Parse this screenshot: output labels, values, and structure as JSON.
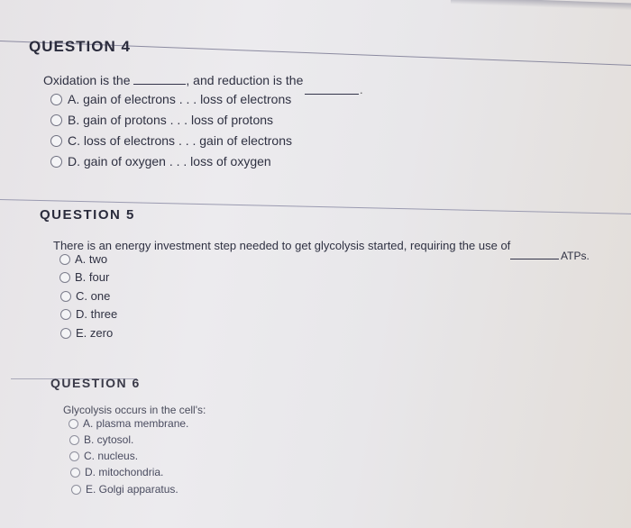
{
  "questions": [
    {
      "title": "QUESTION 4",
      "prompt_part1": "Oxidation is the",
      "prompt_part2": ", and reduction is the",
      "prompt_end": ".",
      "options": [
        {
          "letter": "A",
          "label": "A. gain of electrons . . . loss of electrons",
          "selected": false
        },
        {
          "letter": "B",
          "label": "B. gain of protons . . . loss of protons",
          "selected": false
        },
        {
          "letter": "C",
          "label": "C. loss of electrons . . . gain of electrons",
          "selected": false
        },
        {
          "letter": "D",
          "label": "D. gain of oxygen . . . loss of oxygen",
          "selected": false
        }
      ]
    },
    {
      "title": "QUESTION 5",
      "prompt_part1": "There is an energy investment step needed to get glycolysis started, requiring the use of",
      "prompt_part2": "ATPs.",
      "options": [
        {
          "letter": "A",
          "label": "A. two",
          "selected": false
        },
        {
          "letter": "B",
          "label": "B. four",
          "selected": false
        },
        {
          "letter": "C",
          "label": "C. one",
          "selected": false
        },
        {
          "letter": "D",
          "label": "D. three",
          "selected": false
        },
        {
          "letter": "E",
          "label": "E. zero",
          "selected": false
        }
      ]
    },
    {
      "title": "QUESTION 6",
      "prompt_part1": "Glycolysis occurs in the cell's:",
      "options": [
        {
          "letter": "A",
          "label": "A. plasma membrane.",
          "selected": false
        },
        {
          "letter": "B",
          "label": "B. cytosol.",
          "selected": false
        },
        {
          "letter": "C",
          "label": "C. nucleus.",
          "selected": false
        },
        {
          "letter": "D",
          "label": "D. mitochondria.",
          "selected": false
        },
        {
          "letter": "E",
          "label": "E. Golgi apparatus.",
          "selected": false
        }
      ]
    }
  ]
}
